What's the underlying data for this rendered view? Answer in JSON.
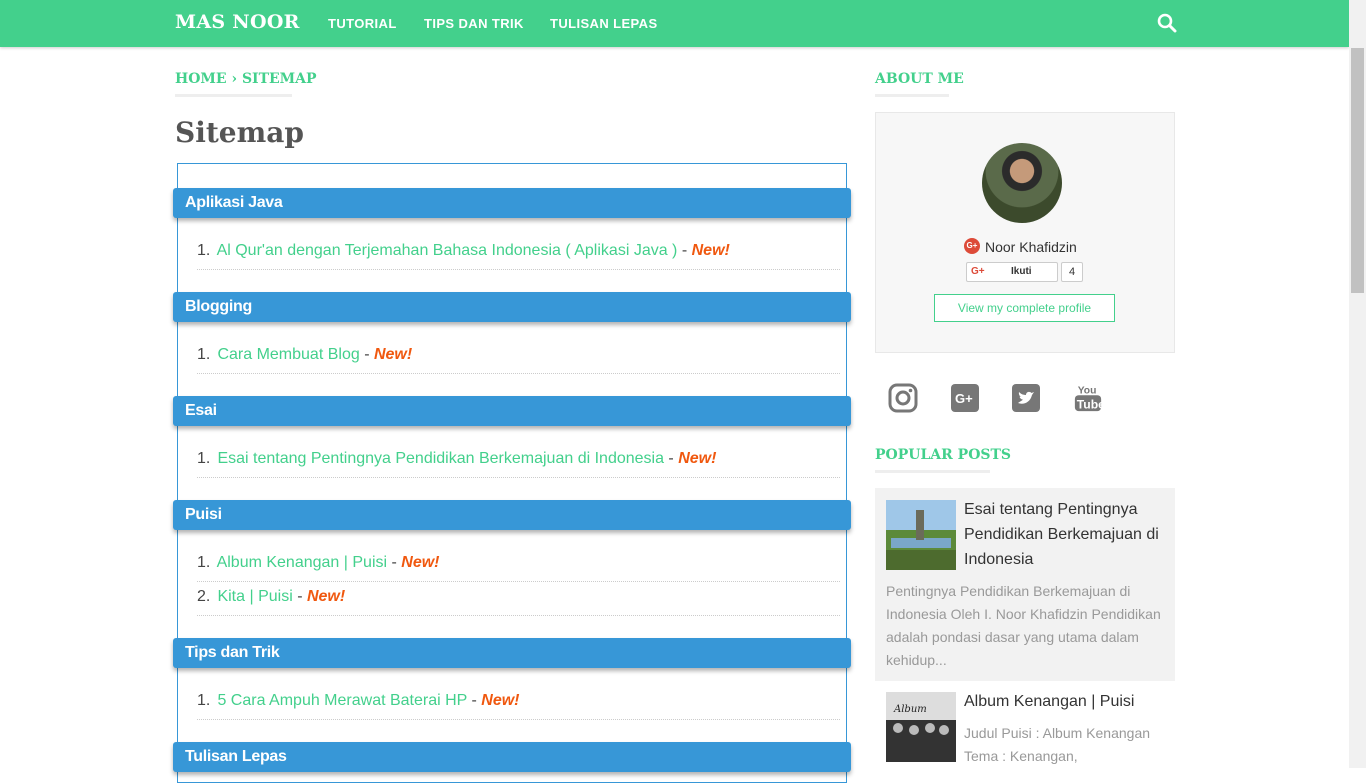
{
  "header": {
    "brand": "MAS NOOR",
    "nav": [
      "TUTORIAL",
      "TIPS DAN TRIK",
      "TULISAN LEPAS"
    ],
    "accent": "#43d08c"
  },
  "breadcrumb": "HOME › SITEMAP",
  "page_title": "Sitemap",
  "new_label": "New!",
  "categories": [
    {
      "name": "Aplikasi Java",
      "items": [
        "Al Qur'an dengan Terjemahan Bahasa Indonesia ( Aplikasi Java )"
      ]
    },
    {
      "name": "Blogging",
      "items": [
        "Cara Membuat Blog"
      ]
    },
    {
      "name": "Esai",
      "items": [
        "Esai tentang Pentingnya Pendidikan Berkemajuan di Indonesia"
      ]
    },
    {
      "name": "Puisi",
      "items": [
        "Album Kenangan | Puisi",
        "Kita | Puisi"
      ]
    },
    {
      "name": "Tips dan Trik",
      "items": [
        "5 Cara Ampuh Merawat Baterai HP"
      ]
    },
    {
      "name": "Tulisan Lepas",
      "items": []
    }
  ],
  "about": {
    "heading": "ABOUT ME",
    "name": "Noor Khafidzin",
    "follow_label": "Ikuti",
    "follow_count": "4",
    "profile_button": "View my complete profile",
    "social_icons": [
      "instagram-icon",
      "google-plus-icon",
      "twitter-icon",
      "youtube-icon"
    ]
  },
  "popular": {
    "heading": "POPULAR POSTS",
    "posts": [
      {
        "title": "Esai tentang Pentingnya Pendidikan Berkemajuan di Indonesia",
        "excerpt": [
          "Pentingnya Pendidikan Berkemajuan di",
          "Indonesia Oleh I. Noor Khafidzin Pendidikan",
          "adalah pondasi dasar yang utama dalam",
          "kehidup..."
        ]
      },
      {
        "title": "Album Kenangan | Puisi",
        "excerpt": [
          "Judul Puisi : Album Kenangan",
          "Tema : Kenangan,"
        ]
      }
    ]
  }
}
